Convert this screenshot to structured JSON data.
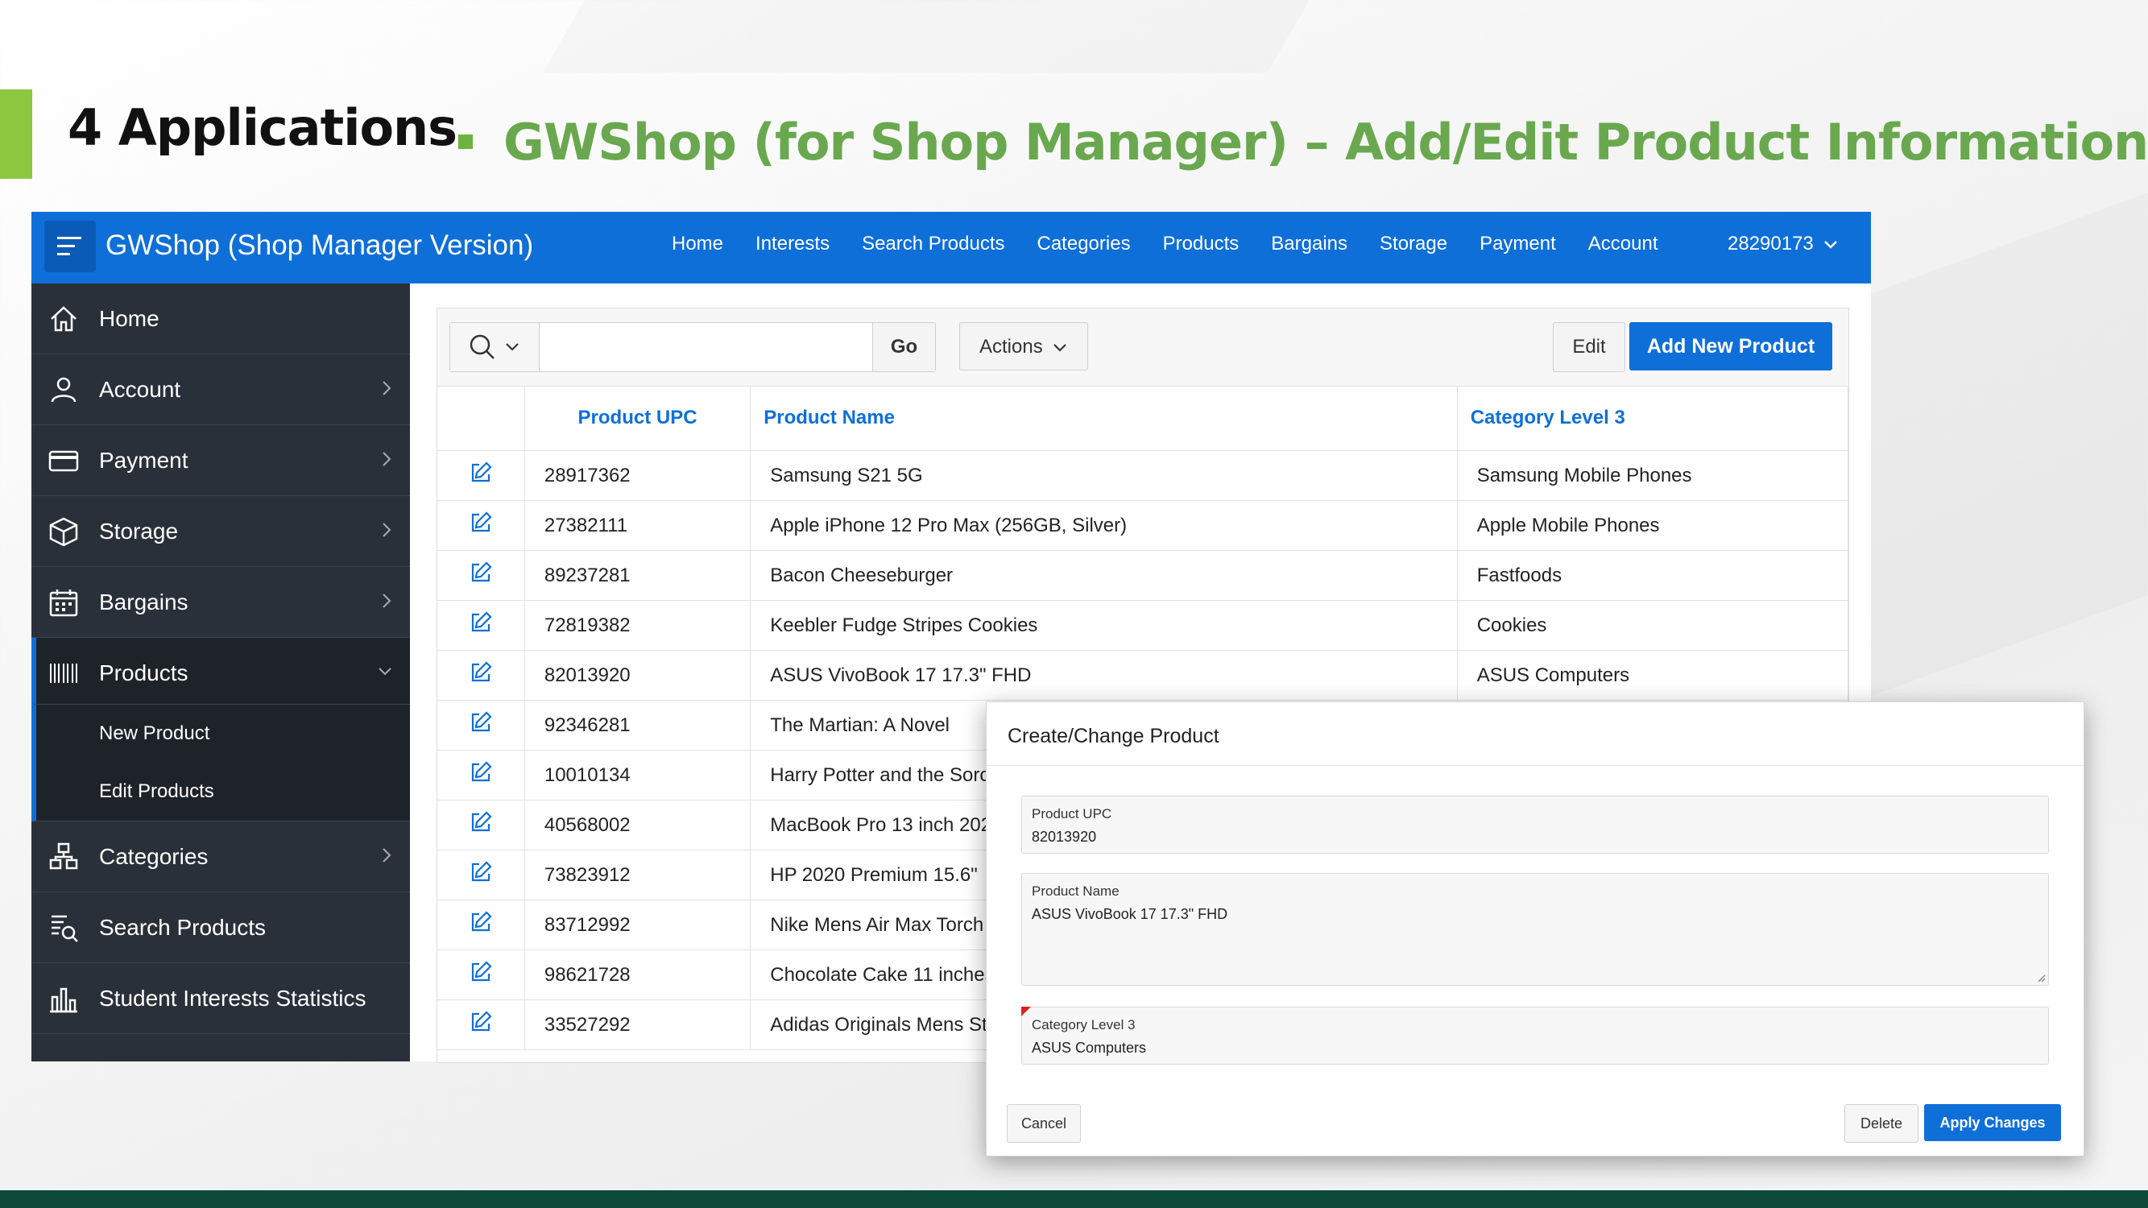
{
  "slide": {
    "title": "4 Applications",
    "subtitle": "GWShop (for Shop Manager) – Add/Edit Product Information"
  },
  "app": {
    "title": "GWShop (Shop Manager Version)",
    "topnav": [
      "Home",
      "Interests",
      "Search Products",
      "Categories",
      "Products",
      "Bargains",
      "Storage",
      "Payment",
      "Account"
    ],
    "user": "28290173"
  },
  "sidebar": {
    "items": [
      {
        "label": "Home",
        "icon": "home-icon"
      },
      {
        "label": "Account",
        "icon": "user-icon"
      },
      {
        "label": "Payment",
        "icon": "credit-card-icon"
      },
      {
        "label": "Storage",
        "icon": "box-icon"
      },
      {
        "label": "Bargains",
        "icon": "calendar-icon"
      },
      {
        "label": "Products",
        "icon": "barcode-icon"
      },
      {
        "label": "Categories",
        "icon": "hierarchy-icon"
      },
      {
        "label": "Search Products",
        "icon": "search-list-icon"
      },
      {
        "label": "Student Interests Statistics",
        "icon": "bar-chart-icon"
      }
    ],
    "products_sub": [
      "New Product",
      "Edit Products"
    ]
  },
  "toolbar": {
    "go_label": "Go",
    "actions_label": "Actions",
    "edit_label": "Edit",
    "add_label": "Add New Product"
  },
  "table": {
    "headers": [
      "Product UPC",
      "Product Name",
      "Category Level 3"
    ],
    "rows": [
      [
        "28917362",
        "Samsung S21 5G",
        "Samsung Mobile Phones"
      ],
      [
        "27382111",
        "Apple iPhone 12 Pro Max (256GB, Silver)",
        "Apple Mobile Phones"
      ],
      [
        "89237281",
        "Bacon Cheeseburger",
        "Fastfoods"
      ],
      [
        "72819382",
        "Keebler Fudge Stripes Cookies",
        "Cookies"
      ],
      [
        "82013920",
        "ASUS VivoBook 17 17.3\" FHD",
        "ASUS Computers"
      ],
      [
        "92346281",
        "The Martian: A Novel",
        ""
      ],
      [
        "10010134",
        "Harry Potter and the Sorc",
        ""
      ],
      [
        "40568002",
        "MacBook Pro 13 inch 202",
        ""
      ],
      [
        "73823912",
        "HP 2020 Premium 15.6\"",
        ""
      ],
      [
        "83712992",
        "Nike Mens Air Max Torch",
        ""
      ],
      [
        "98621728",
        "Chocolate Cake 11 inches",
        ""
      ],
      [
        "33527292",
        "Adidas Originals Mens St",
        ""
      ]
    ]
  },
  "dialog": {
    "title": "Create/Change Product",
    "upc_label": "Product UPC",
    "upc_value": "82013920",
    "name_label": "Product Name",
    "name_value": "ASUS VivoBook 17 17.3\" FHD",
    "category_label": "Category Level 3",
    "category_value": "ASUS Computers",
    "cancel_label": "Cancel",
    "delete_label": "Delete",
    "apply_label": "Apply Changes"
  },
  "colors": {
    "brand_blue": "#0e6fd8",
    "sidebar_bg": "#2a3039",
    "accent_green": "#6aa84f"
  }
}
